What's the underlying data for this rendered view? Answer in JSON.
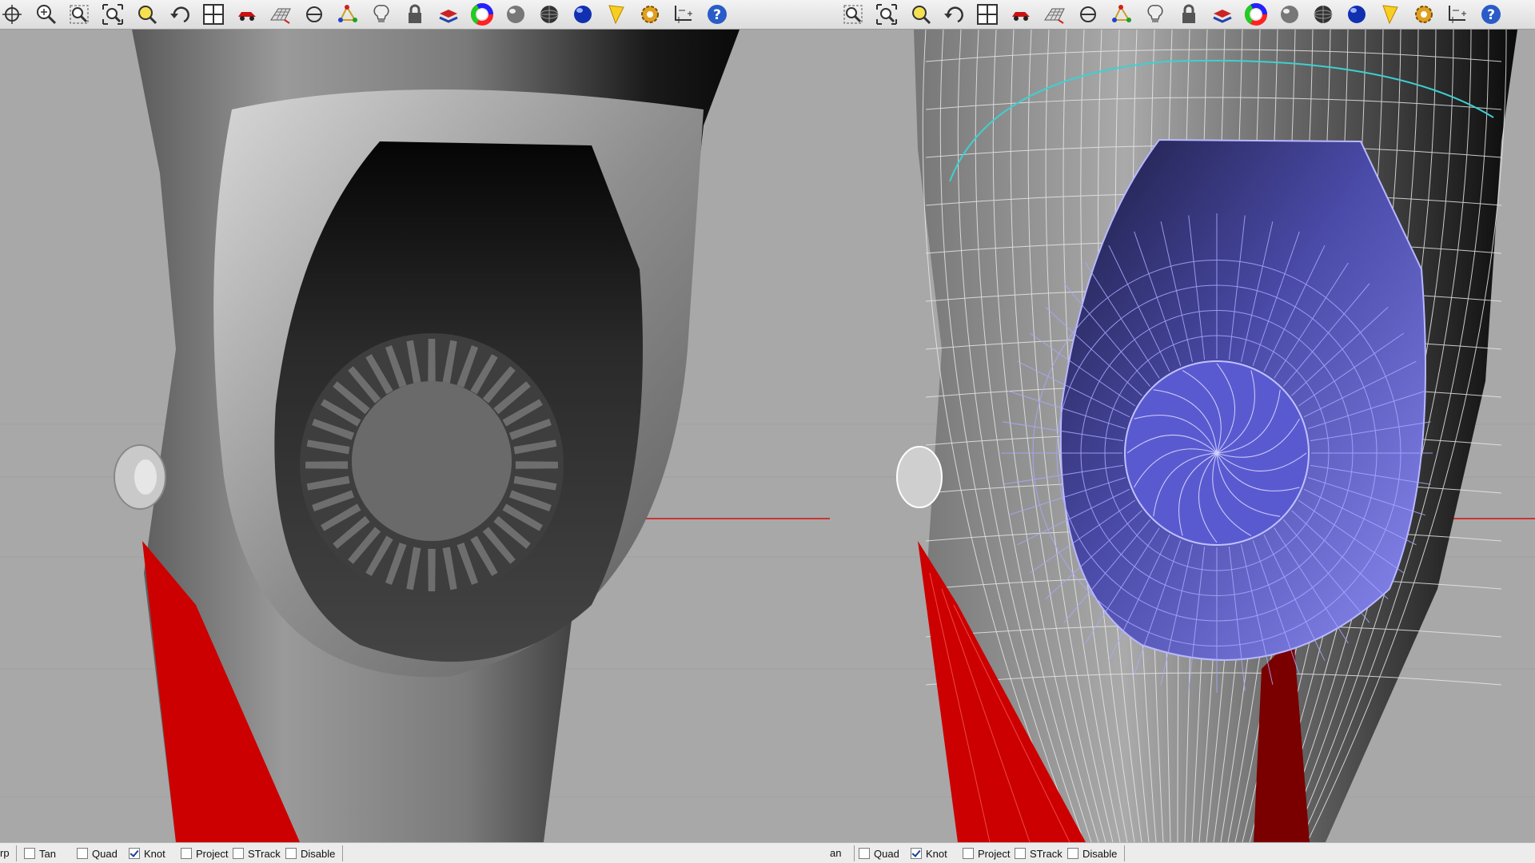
{
  "panels": [
    {
      "id": "left",
      "viewport_mode": "shaded",
      "toolbar_icons": [
        "rotate-view-icon",
        "zoom-in-out-icon",
        "zoom-window-icon",
        "zoom-extents-icon",
        "zoom-selected-icon",
        "undo-view-icon",
        "four-viewports-icon",
        "car-render-icon",
        "grid-plane-icon",
        "construction-plane-icon",
        "point-cloud-icon",
        "light-bulb-icon",
        "lock-icon",
        "layer-stack-icon",
        "color-wheel-icon",
        "shaded-sphere-icon",
        "rendered-sphere-icon",
        "blue-sphere-icon",
        "render-yellow-icon",
        "settings-gear-icon",
        "dimension-icon",
        "help-icon"
      ],
      "status": {
        "partial_label": "rp",
        "osnaps": [
          {
            "label": "Tan",
            "checked": false
          },
          {
            "label": "Quad",
            "checked": false
          },
          {
            "label": "Knot",
            "checked": true
          },
          {
            "label": "Project",
            "checked": false
          },
          {
            "label": "STrack",
            "checked": false
          },
          {
            "label": "Disable",
            "checked": false
          }
        ]
      }
    },
    {
      "id": "right",
      "viewport_mode": "wireframe-selected",
      "toolbar_icons": [
        "zoom-window-icon",
        "zoom-extents-icon",
        "zoom-selected-icon",
        "undo-view-icon",
        "four-viewports-icon",
        "car-render-icon",
        "grid-plane-icon",
        "construction-plane-icon",
        "point-cloud-icon",
        "light-bulb-icon",
        "lock-icon",
        "layer-stack-icon",
        "color-wheel-icon",
        "shaded-sphere-icon",
        "rendered-sphere-icon",
        "blue-sphere-icon",
        "render-yellow-icon",
        "settings-gear-icon",
        "dimension-icon",
        "help-icon"
      ],
      "status": {
        "partial_label": "an",
        "osnaps": [
          {
            "label": "Quad",
            "checked": false
          },
          {
            "label": "Knot",
            "checked": true
          },
          {
            "label": "Project",
            "checked": false
          },
          {
            "label": "STrack",
            "checked": false
          },
          {
            "label": "Disable",
            "checked": false
          }
        ]
      }
    }
  ],
  "colors": {
    "background": "#a8a8a8",
    "model_gray": "#8a8a8a",
    "accent_red": "#cc0000",
    "selection_blue": "#7777ee",
    "axis_red": "#cc3333",
    "highlight_cyan": "#3fd0d0"
  }
}
